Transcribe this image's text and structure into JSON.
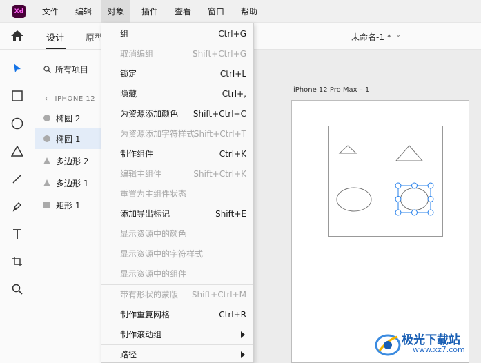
{
  "app": {
    "logo_text": "Xd"
  },
  "menubar": {
    "items": [
      "文件",
      "编辑",
      "对象",
      "插件",
      "查看",
      "窗口",
      "帮助"
    ],
    "active": "对象"
  },
  "tabs": {
    "design": "设计",
    "prototype": "原型"
  },
  "document": {
    "title": "未命名-1 *"
  },
  "layers": {
    "search_label": "所有项目",
    "breadcrumb": "IPHONE 12",
    "items": [
      {
        "label": "椭圆 2",
        "icon": "ellipse-icon",
        "selected": false
      },
      {
        "label": "椭圆 1",
        "icon": "ellipse-icon",
        "selected": true
      },
      {
        "label": "多边形 2",
        "icon": "triangle-icon",
        "selected": false
      },
      {
        "label": "多边形 1",
        "icon": "triangle-icon",
        "selected": false
      },
      {
        "label": "矩形 1",
        "icon": "rectangle-icon",
        "selected": false
      }
    ]
  },
  "canvas": {
    "artboard_label": "iPhone 12 Pro Max – 1"
  },
  "object_menu": {
    "items": [
      {
        "label": "组",
        "shortcut": "Ctrl+G",
        "disabled": false
      },
      {
        "label": "取消编组",
        "shortcut": "Shift+Ctrl+G",
        "disabled": true
      },
      {
        "label": "锁定",
        "shortcut": "Ctrl+L",
        "disabled": false
      },
      {
        "label": "隐藏",
        "shortcut": "Ctrl+,",
        "disabled": false
      },
      {
        "label": "为资源添加颜色",
        "shortcut": "Shift+Ctrl+C",
        "disabled": false
      },
      {
        "label": "为资源添加字符样式",
        "shortcut": "Shift+Ctrl+T",
        "disabled": true
      },
      {
        "label": "制作组件",
        "shortcut": "Ctrl+K",
        "disabled": false
      },
      {
        "label": "编辑主组件",
        "shortcut": "Shift+Ctrl+K",
        "disabled": true
      },
      {
        "label": "重置为主组件状态",
        "shortcut": "",
        "disabled": true
      },
      {
        "label": "添加导出标记",
        "shortcut": "Shift+E",
        "disabled": false
      },
      {
        "label": "显示资源中的颜色",
        "shortcut": "",
        "disabled": true
      },
      {
        "label": "显示资源中的字符样式",
        "shortcut": "",
        "disabled": true
      },
      {
        "label": "显示资源中的组件",
        "shortcut": "",
        "disabled": true
      },
      {
        "label": "带有形状的蒙版",
        "shortcut": "Shift+Ctrl+M",
        "disabled": true
      },
      {
        "label": "制作重复网格",
        "shortcut": "Ctrl+R",
        "disabled": false
      },
      {
        "label": "制作滚动组",
        "shortcut": "",
        "disabled": false,
        "submenu": true
      },
      {
        "label": "路径",
        "shortcut": "",
        "disabled": false,
        "submenu": true
      }
    ]
  },
  "watermark": {
    "text": "极光下载站",
    "url": "www.xz7.com"
  },
  "colors": {
    "accent": "#2680eb",
    "logo_bg": "#470137",
    "logo_fg": "#ff61f6"
  }
}
